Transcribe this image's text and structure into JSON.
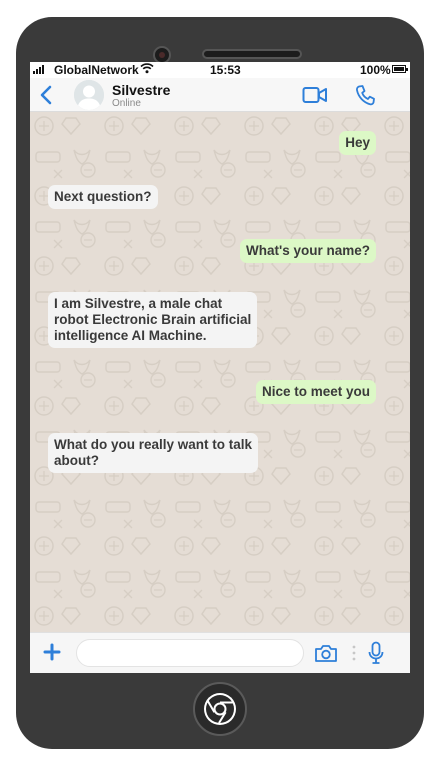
{
  "status_bar": {
    "carrier": "GlobalNetwork",
    "time": "15:53",
    "battery": "100%"
  },
  "header": {
    "contact_name": "Silvestre",
    "contact_status": "Online",
    "icons": [
      "back-arrow-icon",
      "avatar",
      "video-call-icon",
      "phone-call-icon"
    ]
  },
  "messages": [
    {
      "direction": "outgoing",
      "text": "Hey"
    },
    {
      "direction": "incoming",
      "text": "Next question?"
    },
    {
      "direction": "outgoing",
      "text": "What's your name?"
    },
    {
      "direction": "incoming",
      "text": "I am Silvestre, a male chat\nrobot Electronic Brain artificial\nintelligence AI Machine."
    },
    {
      "direction": "outgoing",
      "text": "Nice to meet you"
    },
    {
      "direction": "incoming",
      "text": "What do you really want to talk\nabout?"
    }
  ],
  "input_bar": {
    "placeholder": "",
    "value": "",
    "icons": [
      "plus-icon",
      "camera-icon",
      "microphone-icon"
    ]
  },
  "colors": {
    "accent": "#2e7fd9",
    "outgoing_bubble": "#dcf8c6",
    "incoming_bubble": "#f4f4f4",
    "chat_background": "#e5ddd5",
    "phone_body": "#3a3a3a"
  }
}
